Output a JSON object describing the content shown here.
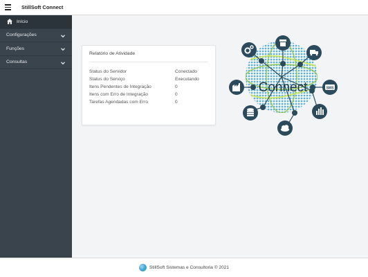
{
  "header": {
    "title": "StillSoft Connect",
    "menu_icon": "hamburger-icon"
  },
  "sidebar": {
    "items": [
      {
        "label": "Início",
        "icon": "home-icon",
        "active": true
      },
      {
        "label": "Configurações",
        "icon": "chevron-down-icon"
      },
      {
        "label": "Funções",
        "icon": "chevron-down-icon"
      },
      {
        "label": "Consultas",
        "icon": "chevron-down-icon"
      }
    ]
  },
  "activity": {
    "title": "Relatório de Atividade",
    "rows": [
      {
        "label": "Status do Servidor",
        "value": "Conectado"
      },
      {
        "label": "Status do Serviço",
        "value": "Executando"
      },
      {
        "label": "Itens Pendentes de Integração",
        "value": "0"
      },
      {
        "label": "Itens com Erro de Integração",
        "value": "0"
      },
      {
        "label": "Tarefas Agendadas com Erro",
        "value": "0"
      }
    ]
  },
  "logo": {
    "text": "Connect",
    "node_color": "#2b4a5c",
    "icons": [
      "store-icon",
      "truck-icon",
      "sms-icon",
      "bar-chart-icon",
      "cloud-icon",
      "database-icon",
      "factory-icon",
      "gears-icon"
    ]
  },
  "footer": {
    "text": "StillSoft Sistemas e Consultoria © 2021"
  },
  "colors": {
    "sidebar": "#3a444c",
    "sidebar_active": "#2c343b",
    "background": "#f3f4f6"
  }
}
